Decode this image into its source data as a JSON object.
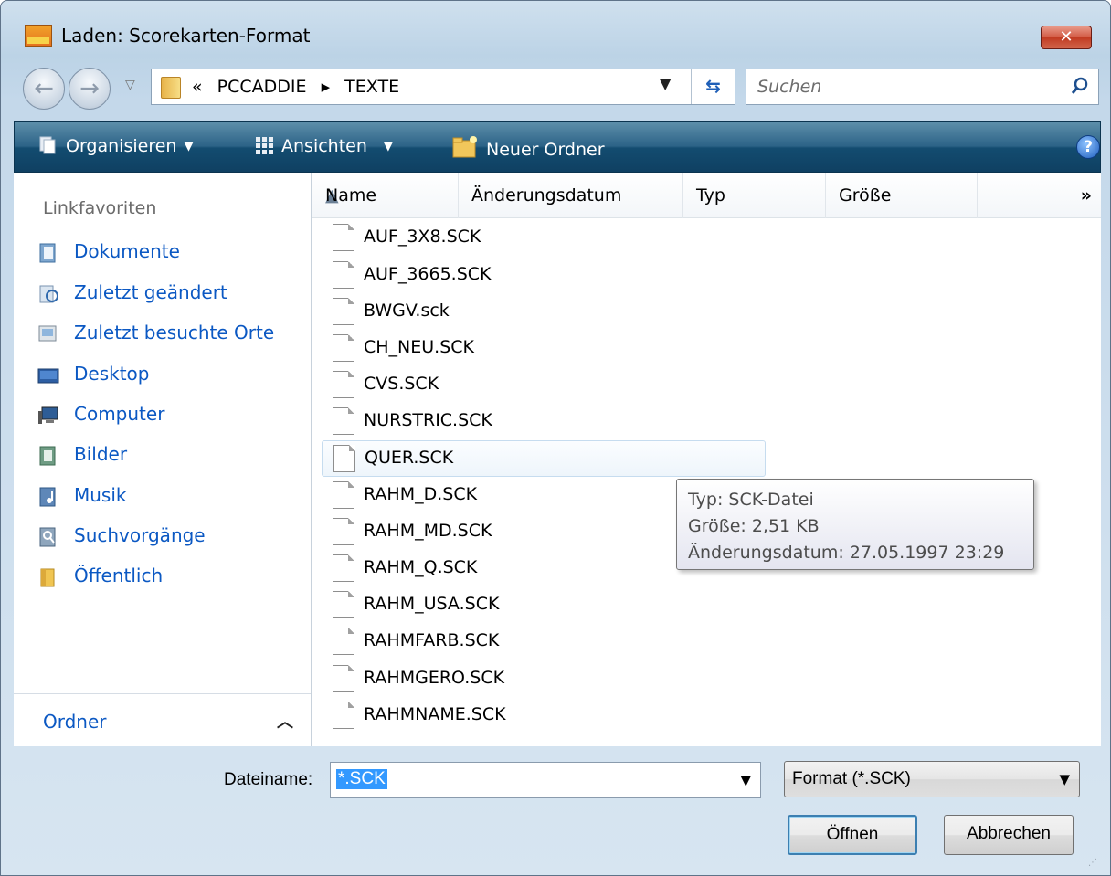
{
  "window": {
    "title": "Laden: Scorekarten-Format",
    "close_label": "✕"
  },
  "nav": {
    "path": [
      "«",
      "PCCADDIE",
      "▸",
      "TEXTE"
    ],
    "search_placeholder": "Suchen"
  },
  "toolbar": {
    "organize": "Organisieren",
    "views": "Ansichten",
    "new_folder": "Neuer Ordner",
    "help": "?"
  },
  "sidebar": {
    "header": "Linkfavoriten",
    "items": [
      {
        "label": "Dokumente",
        "icon": "documents-icon"
      },
      {
        "label": "Zuletzt geändert",
        "icon": "recent-changed-icon"
      },
      {
        "label": "Zuletzt besuchte Orte",
        "icon": "recent-places-icon"
      },
      {
        "label": "Desktop",
        "icon": "desktop-icon"
      },
      {
        "label": "Computer",
        "icon": "computer-icon"
      },
      {
        "label": "Bilder",
        "icon": "pictures-icon"
      },
      {
        "label": "Musik",
        "icon": "music-icon"
      },
      {
        "label": "Suchvorgänge",
        "icon": "searches-icon"
      },
      {
        "label": "Öffentlich",
        "icon": "public-folder-icon"
      }
    ],
    "folders_label": "Ordner"
  },
  "columns": [
    "Name",
    "Änderungsdatum",
    "Typ",
    "Größe"
  ],
  "files": [
    "AUF_3X8.SCK",
    "AUF_3665.SCK",
    "BWGV.sck",
    "CH_NEU.SCK",
    "CVS.SCK",
    "NURSTRIC.SCK",
    "QUER.SCK",
    "RAHM_D.SCK",
    "RAHM_MD.SCK",
    "RAHM_Q.SCK",
    "RAHM_USA.SCK",
    "RAHMFARB.SCK",
    "RAHMGERO.SCK",
    "RAHMNAME.SCK"
  ],
  "hovered_file": "QUER.SCK",
  "tooltip": {
    "type": "Typ: SCK-Datei",
    "size": "Größe: 2,51 KB",
    "modified": "Änderungsdatum: 27.05.1997 23:29"
  },
  "bottom": {
    "filename_label": "Dateiname:",
    "filename_value": "*.SCK",
    "filter_value": "Format (*.SCK)",
    "open_label": "Öffnen",
    "cancel_label": "Abbrechen"
  }
}
